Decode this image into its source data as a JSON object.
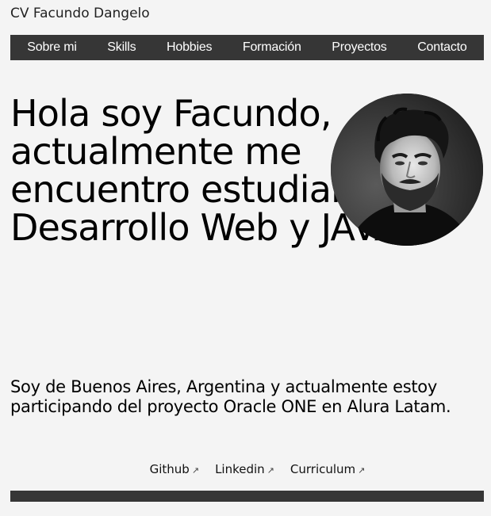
{
  "site": {
    "title": "CV Facundo Dangelo"
  },
  "nav": {
    "items": [
      {
        "label": "Sobre mi"
      },
      {
        "label": "Skills"
      },
      {
        "label": "Hobbies"
      },
      {
        "label": "Formación"
      },
      {
        "label": "Proyectos"
      },
      {
        "label": "Contacto"
      }
    ]
  },
  "hero": {
    "title": "Hola soy Facundo, actualmente me encuentro estudiando: Desarrollo Web y JAVA.",
    "intro": "Soy de Buenos Aires, Argentina y actualmente estoy participando del proyecto Oracle ONE en Alura Latam."
  },
  "links": [
    {
      "label": "Github",
      "icon": "external-link-arrow-icon"
    },
    {
      "label": "Linkedin",
      "icon": "external-link-arrow-icon"
    },
    {
      "label": "Curriculum",
      "icon": "external-link-arrow-icon"
    }
  ],
  "colors": {
    "background": "#f4f4f4",
    "nav_bar": "#363636",
    "text": "#000000"
  }
}
